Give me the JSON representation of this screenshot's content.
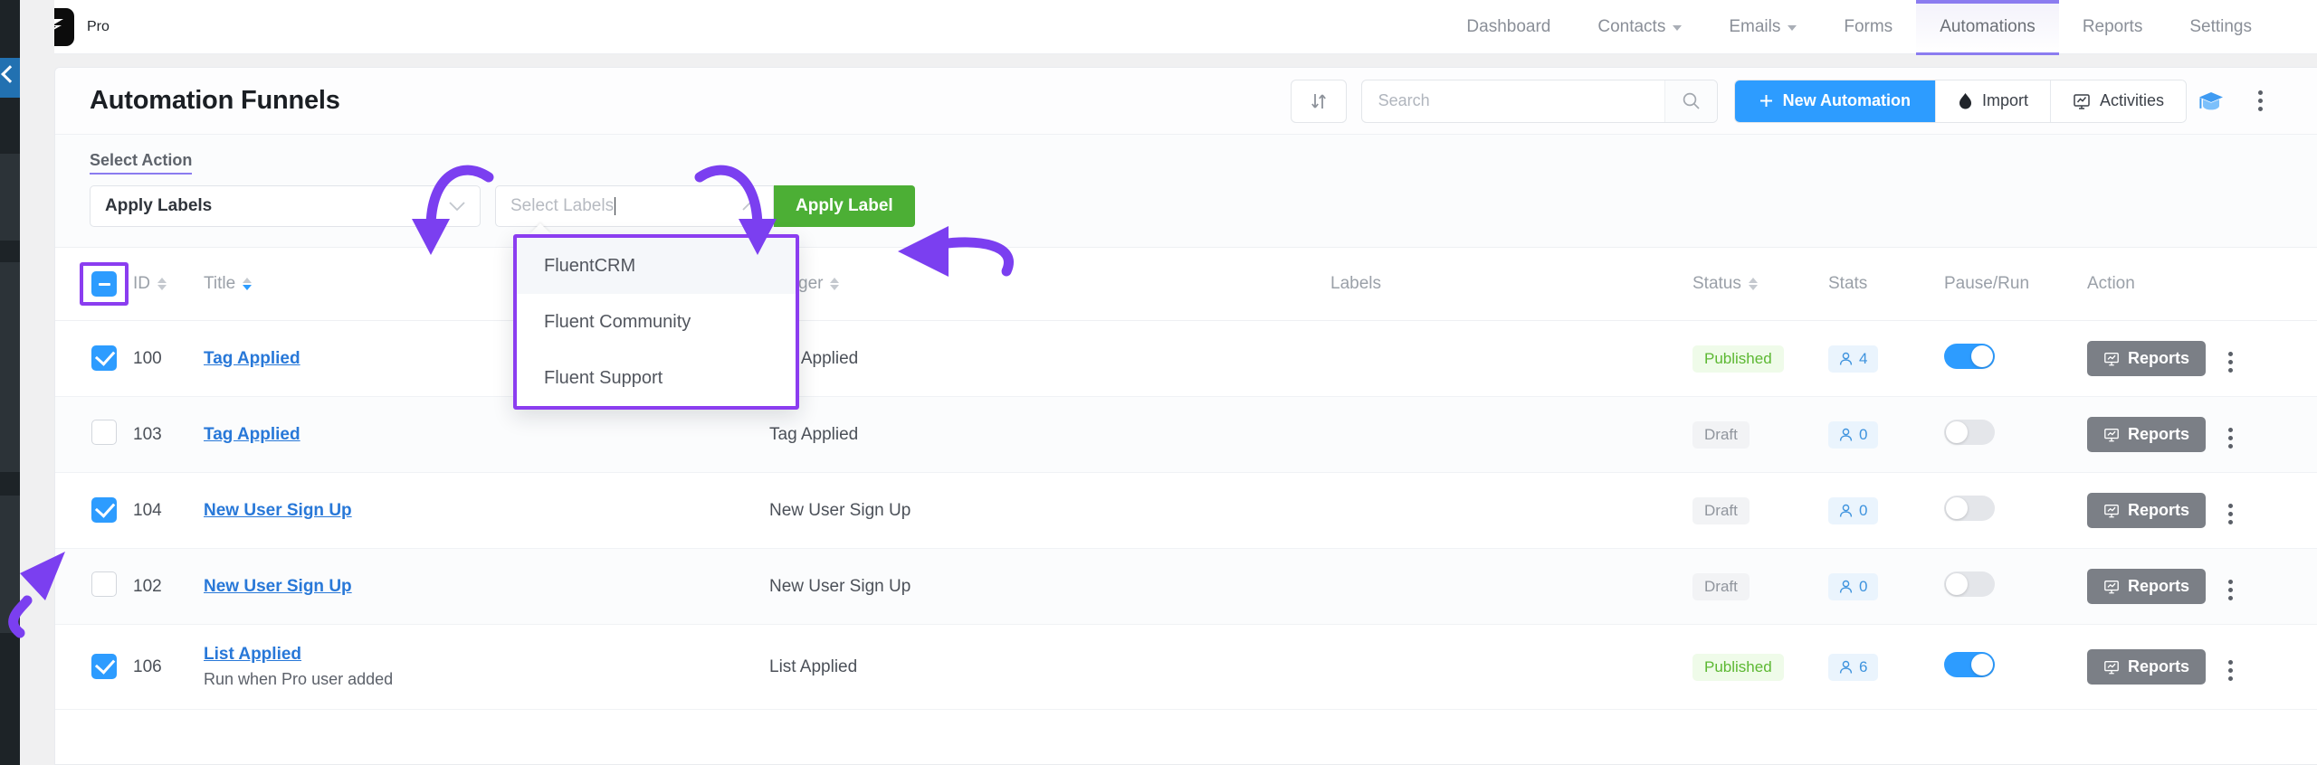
{
  "brand": {
    "name": "Pro",
    "logo_icon": "fluent-logo-icon"
  },
  "topnav": {
    "items": [
      {
        "label": "Dashboard",
        "has_caret": false,
        "active": false
      },
      {
        "label": "Contacts",
        "has_caret": true,
        "active": false
      },
      {
        "label": "Emails",
        "has_caret": true,
        "active": false
      },
      {
        "label": "Forms",
        "has_caret": false,
        "active": false
      },
      {
        "label": "Automations",
        "has_caret": false,
        "active": true
      },
      {
        "label": "Reports",
        "has_caret": false,
        "active": false
      },
      {
        "label": "Settings",
        "has_caret": false,
        "active": false
      }
    ]
  },
  "header": {
    "title": "Automation Funnels",
    "sort_icon": "sort-arrows-icon",
    "search": {
      "value": "",
      "placeholder": "Search",
      "icon": "search-icon"
    },
    "new_automation": {
      "label": "New Automation",
      "icon": "plus-icon"
    },
    "import": {
      "label": "Import",
      "icon": "import-icon"
    },
    "activities": {
      "label": "Activities",
      "icon": "activities-icon"
    },
    "academy_icon": "graduation-cap-icon",
    "more_icon": "kebab-menu-icon"
  },
  "bulk": {
    "section_label": "Select Action",
    "action_select": {
      "value": "Apply Labels",
      "chevron": "chevron-down-icon"
    },
    "labels_select": {
      "value": "",
      "placeholder": "Select Labels",
      "chevron": "chevron-up-icon"
    },
    "apply_button": "Apply Label",
    "dropdown_options": [
      {
        "label": "FluentCRM",
        "highlighted": true
      },
      {
        "label": "Fluent Community",
        "highlighted": false
      },
      {
        "label": "Fluent Support",
        "highlighted": false
      }
    ]
  },
  "table": {
    "select_all_state": "indeterminate",
    "columns": [
      {
        "key": "checkbox",
        "label": "",
        "sortable": false
      },
      {
        "key": "id",
        "label": "ID",
        "sortable": true
      },
      {
        "key": "title",
        "label": "Title",
        "sortable": true
      },
      {
        "key": "trigger",
        "label": "Trigger",
        "sortable": true
      },
      {
        "key": "labels",
        "label": "Labels",
        "sortable": false
      },
      {
        "key": "status",
        "label": "Status",
        "sortable": true
      },
      {
        "key": "stats",
        "label": "Stats",
        "sortable": false
      },
      {
        "key": "pause_run",
        "label": "Pause/Run",
        "sortable": false
      },
      {
        "key": "action",
        "label": "Action",
        "sortable": false
      }
    ],
    "action_button_label": "Reports",
    "rows": [
      {
        "checked": true,
        "id": "100",
        "title": "Tag Applied",
        "subtitle": "",
        "trigger": "Tag Applied",
        "labels": "",
        "status": "Published",
        "status_type": "pub",
        "stats": "4",
        "running": true
      },
      {
        "checked": false,
        "id": "103",
        "title": "Tag Applied",
        "subtitle": "",
        "trigger": "Tag Applied",
        "labels": "",
        "status": "Draft",
        "status_type": "draft",
        "stats": "0",
        "running": false
      },
      {
        "checked": true,
        "id": "104",
        "title": "New User Sign Up",
        "subtitle": "",
        "trigger": "New User Sign Up",
        "labels": "",
        "status": "Draft",
        "status_type": "draft",
        "stats": "0",
        "running": false
      },
      {
        "checked": false,
        "id": "102",
        "title": "New User Sign Up",
        "subtitle": "",
        "trigger": "New User Sign Up",
        "labels": "",
        "status": "Draft",
        "status_type": "draft",
        "stats": "0",
        "running": false
      },
      {
        "checked": true,
        "id": "106",
        "title": "List Applied",
        "subtitle": "Run when Pro user added",
        "trigger": "List Applied",
        "labels": "",
        "status": "Published",
        "status_type": "pub",
        "stats": "6",
        "running": true
      }
    ]
  },
  "colors": {
    "accent_blue": "#2d9cff",
    "annotation_purple": "#7b3ff0",
    "apply_green": "#4caf35",
    "published_green": "#5cb832",
    "nav_active_purple": "#8b7cf0"
  }
}
